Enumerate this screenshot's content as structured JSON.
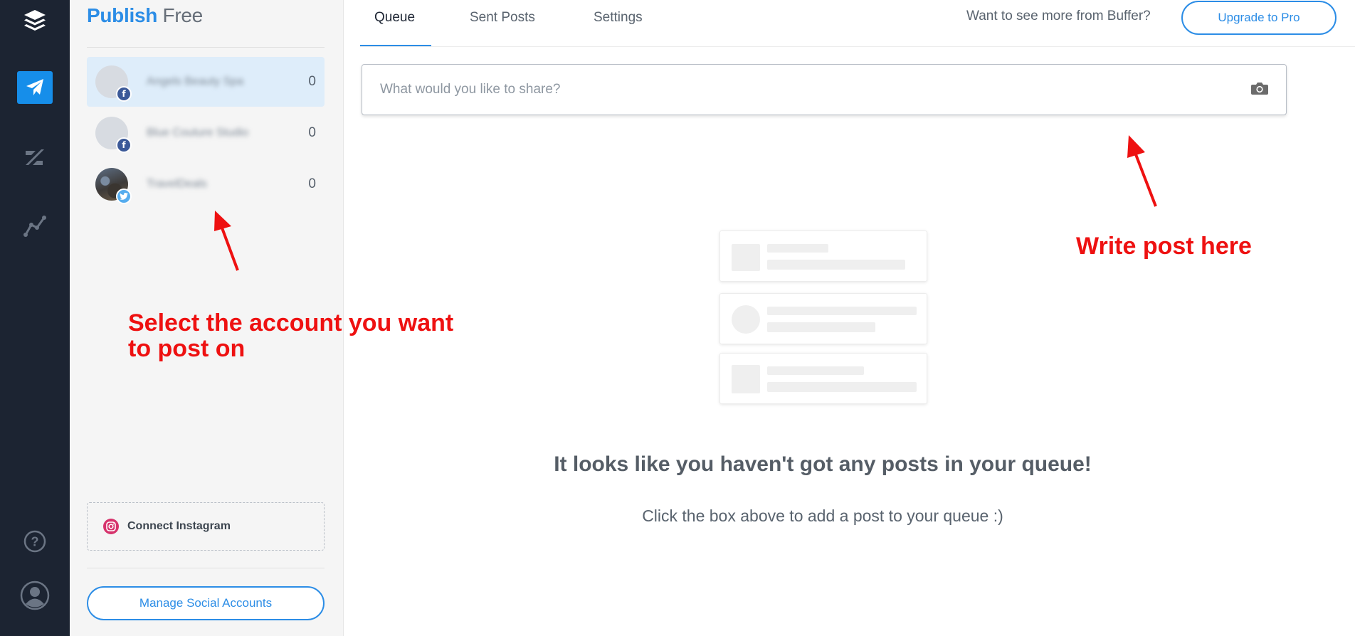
{
  "rail": {
    "items": [
      {
        "name": "buffer-logo-icon"
      },
      {
        "name": "publish-icon",
        "active": true
      },
      {
        "name": "reply-icon"
      },
      {
        "name": "analyze-icon"
      },
      {
        "name": "help-icon"
      },
      {
        "name": "account-icon"
      }
    ]
  },
  "brand": {
    "product": "Publish",
    "plan": "Free"
  },
  "profiles": [
    {
      "name": "Angels Beauty Spa",
      "network": "facebook",
      "count": "0",
      "selected": true
    },
    {
      "name": "Blue Couture Studio",
      "network": "facebook",
      "count": "0",
      "selected": false
    },
    {
      "name": "TravelDeals",
      "network": "twitter",
      "count": "0",
      "selected": false
    }
  ],
  "connect_instagram": {
    "label": "Connect Instagram"
  },
  "manage_accounts": {
    "label": "Manage Social Accounts"
  },
  "tabs": [
    {
      "label": "Queue",
      "active": true
    },
    {
      "label": "Sent Posts",
      "active": false
    },
    {
      "label": "Settings",
      "active": false
    }
  ],
  "header": {
    "promo": "Want to see more from Buffer?",
    "upgrade_label": "Upgrade to Pro"
  },
  "composer": {
    "placeholder": "What would you like to share?"
  },
  "empty_state": {
    "title": "It looks like you haven't got any posts in your queue!",
    "subtitle": "Click the box above to add a post to your queue :)"
  },
  "annotations": {
    "select_account": "Select the account you want\nto post on",
    "write_post": "Write post here"
  },
  "colors": {
    "rail_bg": "#1c2432",
    "accent": "#2c8de6",
    "annotation": "#ee1111",
    "facebook": "#3b5998",
    "twitter": "#55acee"
  }
}
